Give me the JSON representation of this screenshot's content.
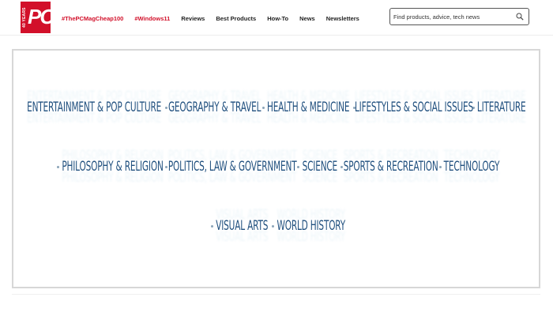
{
  "logo": {
    "years": "40 YEARS",
    "mark": "PC"
  },
  "nav": {
    "links": [
      {
        "label": "#ThePCMagCheap100",
        "hot": true
      },
      {
        "label": "#Windows11",
        "hot": true
      },
      {
        "label": "Reviews",
        "hot": false
      },
      {
        "label": "Best Products",
        "hot": false
      },
      {
        "label": "How-To",
        "hot": false
      },
      {
        "label": "News",
        "hot": false
      },
      {
        "label": "Newsletters",
        "hot": false
      }
    ]
  },
  "search": {
    "placeholder": "Find products, advice, tech news",
    "icon": "magnifier-icon"
  },
  "topics": {
    "rows": [
      [
        "ENTERTAINMENT & POP CULTURE",
        "GEOGRAPHY & TRAVEL",
        "HEALTH & MEDICINE",
        "LIFESTYLES & SOCIAL ISSUES",
        "LITERATURE"
      ],
      [
        "PHILOSOPHY & RELIGION",
        "POLITICS, LAW & GOVERNMENT",
        "SCIENCE",
        "SPORTS & RECREATION",
        "TECHNOLOGY"
      ],
      [
        "VISUAL ARTS",
        "WORLD HISTORY"
      ]
    ]
  },
  "colors": {
    "brand": "#d2102a",
    "topic_text": "#1f4f7e"
  }
}
